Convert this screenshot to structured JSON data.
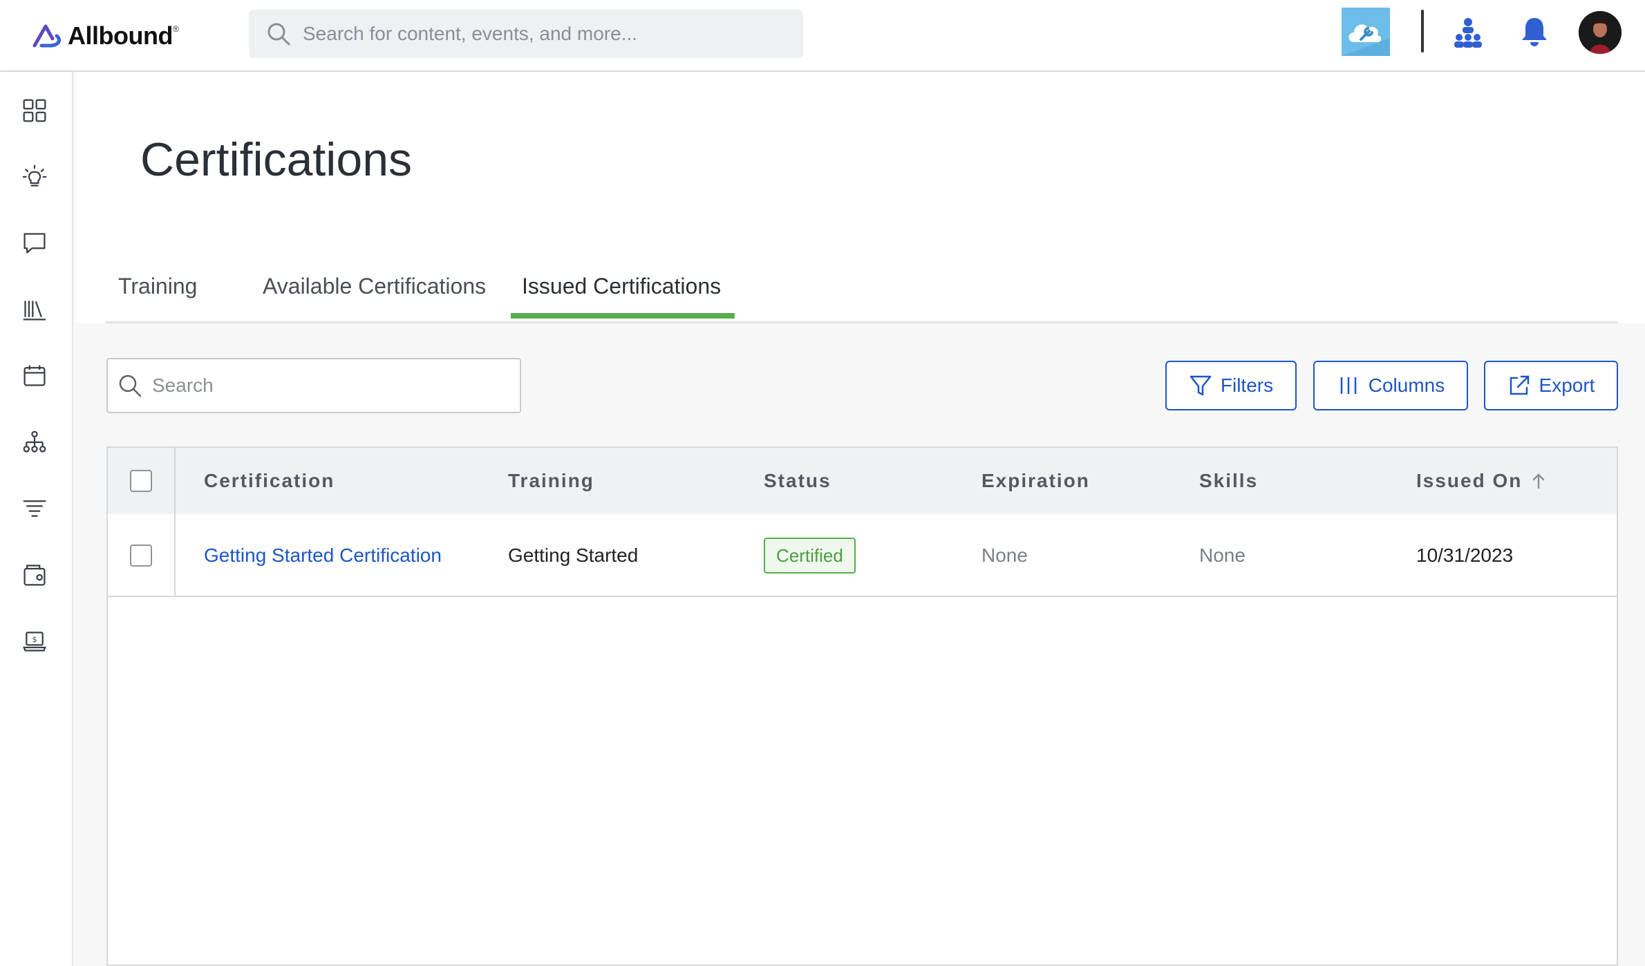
{
  "app": {
    "brand": "Allbound",
    "search_placeholder": "Search for content, events, and more..."
  },
  "header_icons": [
    "cloud-wrench-icon",
    "org-chart-icon",
    "bell-icon",
    "avatar"
  ],
  "sidebar": {
    "items": [
      {
        "icon": "dashboard-grid-icon"
      },
      {
        "icon": "lightbulb-icon"
      },
      {
        "icon": "chat-bubble-icon"
      },
      {
        "icon": "library-icon"
      },
      {
        "icon": "calendar-icon"
      },
      {
        "icon": "hierarchy-icon"
      },
      {
        "icon": "filter-lines-icon"
      },
      {
        "icon": "wallet-icon"
      },
      {
        "icon": "laptop-dollar-icon"
      }
    ]
  },
  "page": {
    "title": "Certifications"
  },
  "tabs": [
    {
      "label": "Training",
      "active": false
    },
    {
      "label": "Available Certifications",
      "active": false
    },
    {
      "label": "Issued Certifications",
      "active": true
    }
  ],
  "toolbar": {
    "search_placeholder": "Search",
    "filters_label": "Filters",
    "columns_label": "Columns",
    "export_label": "Export"
  },
  "table": {
    "columns": [
      "Certification",
      "Training",
      "Status",
      "Expiration",
      "Skills",
      "Issued On"
    ],
    "sort_column": "Issued On",
    "sort_direction": "ascending",
    "rows": [
      {
        "certification": "Getting Started Certification",
        "training": "Getting Started",
        "status": "Certified",
        "expiration": "None",
        "skills": "None",
        "issued_on": "10/31/2023"
      }
    ]
  },
  "colors": {
    "accent_blue": "#1e55c4",
    "tab_active_green": "#59ad4f",
    "header_icon_blue": "#2f5fd0"
  }
}
